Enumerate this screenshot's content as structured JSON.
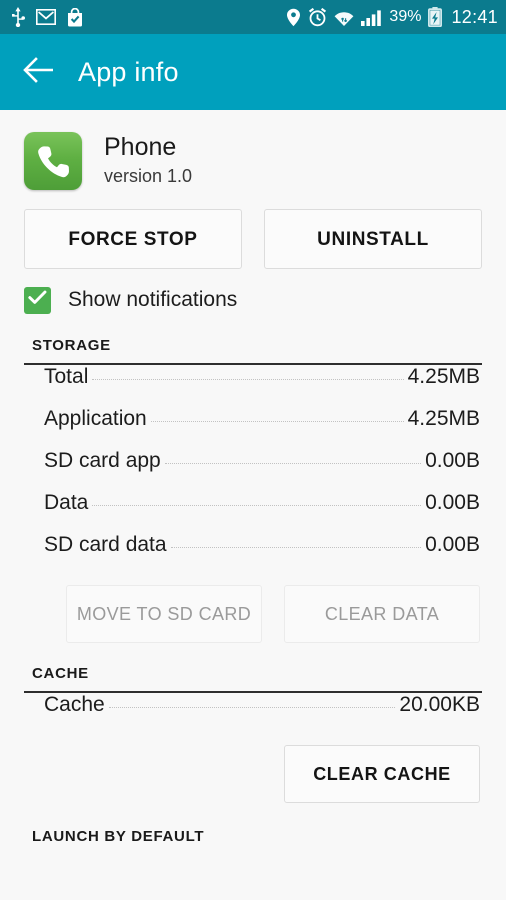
{
  "status_bar": {
    "left_icons": [
      "usb-icon",
      "gmail-icon",
      "play-store-icon"
    ],
    "right_icons": [
      "location-icon",
      "alarm-icon",
      "wifi-icon",
      "signal-icon",
      "battery-charging-icon"
    ],
    "battery_percent": "39%",
    "clock": "12:41",
    "background_color": "#0b7b8e"
  },
  "action_bar": {
    "title": "App info",
    "back_icon": "arrow-left-icon",
    "background_color": "#00a0bd"
  },
  "app": {
    "icon": "phone-icon",
    "icon_color": "#5fb043",
    "name": "Phone",
    "version": "version 1.0"
  },
  "top_actions": {
    "force_stop": "FORCE STOP",
    "uninstall": "UNINSTALL"
  },
  "notifications": {
    "label": "Show notifications",
    "checked": true,
    "checkbox_color": "#4caf50"
  },
  "storage": {
    "title": "STORAGE",
    "rows": [
      {
        "label": "Total",
        "value": "4.25MB"
      },
      {
        "label": "Application",
        "value": "4.25MB"
      },
      {
        "label": "SD card app",
        "value": "0.00B"
      },
      {
        "label": "Data",
        "value": "0.00B"
      },
      {
        "label": "SD card data",
        "value": "0.00B"
      }
    ],
    "buttons": {
      "move_to_sd": "MOVE TO SD CARD",
      "clear_data": "CLEAR DATA"
    }
  },
  "cache": {
    "title": "CACHE",
    "rows": [
      {
        "label": "Cache",
        "value": "20.00KB"
      }
    ],
    "buttons": {
      "clear_cache": "CLEAR CACHE"
    }
  },
  "launch_by_default": {
    "title": "LAUNCH BY DEFAULT"
  }
}
